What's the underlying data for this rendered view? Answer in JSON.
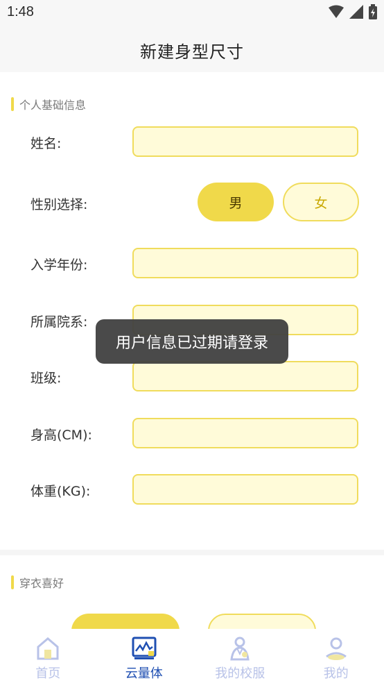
{
  "status_bar": {
    "time": "1:48"
  },
  "header": {
    "title": "新建身型尺寸"
  },
  "basic_info": {
    "section_title": "个人基础信息",
    "name_label": "姓名:",
    "gender_label": "性别选择:",
    "gender_male": "男",
    "gender_female": "女",
    "enroll_year_label": "入学年份:",
    "department_label": "所属院系:",
    "class_label": "班级:",
    "height_label": "身高(CM):",
    "weight_label": "体重(KG):"
  },
  "preferences": {
    "section_title": "穿衣喜好"
  },
  "toast": {
    "message": "用户信息已过期请登录"
  },
  "tabbar": {
    "items": [
      {
        "label": "首页",
        "icon": "home-icon",
        "active": false
      },
      {
        "label": "云量体",
        "icon": "measure-chart-icon",
        "active": true
      },
      {
        "label": "我的校服",
        "icon": "uniform-icon",
        "active": false
      },
      {
        "label": "我的",
        "icon": "profile-icon",
        "active": false
      }
    ]
  },
  "colors": {
    "accent": "#f0d94a",
    "input_bg": "#fffbd9",
    "active_tab": "#1f4fb2",
    "inactive_tab": "#b8c2e8"
  }
}
